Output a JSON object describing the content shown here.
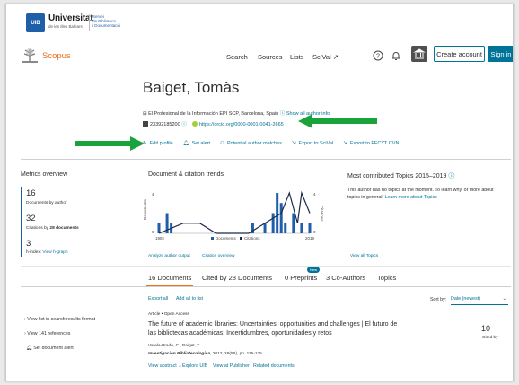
{
  "university": {
    "logo_text": "UIB",
    "name": "Universitat",
    "sub_lines": [
      "de les Illes Balears"
    ],
    "service_lines": [
      "Servei",
      "de Biblioteca",
      "i Documentació"
    ]
  },
  "nav": {
    "brand": "Scopus",
    "links": [
      "Search",
      "Sources",
      "Lists",
      "SciVal ↗"
    ],
    "create_account": "Create account",
    "sign_in": "Sign in"
  },
  "author": {
    "name": "Baiget, Tomàs",
    "affiliation": "El Profesional de la Información EPI SCP, Barcelona, Spain",
    "show_all_info": "Show all author info",
    "scopus_id": "23392185200",
    "orcid": "https://orcid.org/0000-0001-0041-2665",
    "actions": [
      "Edit profile",
      "Set alert",
      "Potential author matches",
      "Export to SciVal",
      "Export to FECYT CVN"
    ]
  },
  "metrics": {
    "title": "Metrics overview",
    "documents_num": "16",
    "documents_lbl": "Documents by author",
    "citations_num": "32",
    "citations_lbl_pre": "Citations by",
    "citations_lbl_bold": "28 documents",
    "hindex_num": "3",
    "hindex_lbl": "h-index:",
    "hindex_link": "View h-graph"
  },
  "trends": {
    "title": "Document & citation trends",
    "analyze_link": "Analyze author output",
    "citation_link": "Citation overview"
  },
  "chart_data": {
    "type": "bar",
    "x_start": "1982",
    "x_end": "2019",
    "ylabel_left": "Documents",
    "ylabel_right": "Citations",
    "left_ticks": [
      "4",
      "0"
    ],
    "right_ticks": [
      "4",
      "0"
    ],
    "legend": [
      "Documents",
      "Citations"
    ],
    "documents": [
      {
        "year": 1982,
        "value": 1
      },
      {
        "year": 1984,
        "value": 2
      },
      {
        "year": 1985,
        "value": 1
      },
      {
        "year": 2005,
        "value": 1
      },
      {
        "year": 2008,
        "value": 1
      },
      {
        "year": 2010,
        "value": 2
      },
      {
        "year": 2011,
        "value": 4
      },
      {
        "year": 2012,
        "value": 3
      },
      {
        "year": 2013,
        "value": 1
      },
      {
        "year": 2015,
        "value": 2
      },
      {
        "year": 2017,
        "value": 1
      },
      {
        "year": 2019,
        "value": 1
      }
    ],
    "citations": [
      {
        "year": 1982,
        "value": 0
      },
      {
        "year": 1988,
        "value": 1
      },
      {
        "year": 1992,
        "value": 1
      },
      {
        "year": 1996,
        "value": 0
      },
      {
        "year": 2000,
        "value": 0
      },
      {
        "year": 2004,
        "value": 0
      },
      {
        "year": 2008,
        "value": 1
      },
      {
        "year": 2012,
        "value": 2
      },
      {
        "year": 2014,
        "value": 4
      },
      {
        "year": 2016,
        "value": 1
      },
      {
        "year": 2017,
        "value": 4
      },
      {
        "year": 2019,
        "value": 2
      }
    ],
    "colors": {
      "documents": "#1f5ea8",
      "citations": "#1a2b4a"
    }
  },
  "topics": {
    "title": "Most contributed Topics 2015–2019",
    "text": "This author has no topics at the moment. To learn why, or more about topics in general,",
    "learn_more": "Learn more about Topics",
    "view_all": "View all Topics"
  },
  "tabs": {
    "items": [
      "16 Documents",
      "Cited by 28 Documents",
      "0 Preprints",
      "3 Co-Authors",
      "Topics"
    ],
    "new_badge": "New"
  },
  "docs": {
    "export_all": "Export all",
    "add_all": "Add all to list",
    "sort_label": "Sort by:",
    "sort_value": "Date (newest)",
    "side_links": [
      "View list in search results format",
      "View 141 references",
      "Set document alert"
    ],
    "item": {
      "type": "Article",
      "access": "Open Access",
      "title": "The future of academic libraries: Uncertainties, opportunities and challenges | El futuro de las bibliotecas académicas: Incertidumbres, oportunidades y retos",
      "authors": "Varela-Prado, C., Baiget, T.",
      "source": "Investigacion Bibliotecologica",
      "source_rest": ", 2012, 26(56), pp. 115-135",
      "links": [
        "View abstract",
        "Explora UIB",
        "View at Publisher",
        "Related documents"
      ],
      "cited_num": "10",
      "cited_lbl": "Cited by"
    }
  },
  "accent_colors": {
    "orange": "#e9711c",
    "blue": "#007398",
    "arrow_green": "#1aa33a"
  }
}
